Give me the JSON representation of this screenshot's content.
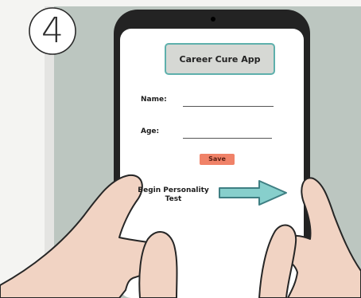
{
  "step": {
    "number": "4"
  },
  "app": {
    "title": "Career Cure App",
    "form": {
      "name_label": "Name:",
      "name_value": "",
      "age_label": "Age:",
      "age_value": "",
      "save_label": "Save"
    },
    "begin_test": {
      "line1": "Begin Personality",
      "line2": "Test"
    }
  },
  "colors": {
    "wall": "#bcc6c0",
    "phone": "#232323",
    "screen": "#ffffff",
    "title_box": "#d6d8d4",
    "title_border": "#5eb0ac",
    "save_button": "#f08268",
    "arrow_fill": "#87cfcc",
    "arrow_stroke": "#3f7f83",
    "skin": "#f1d3c3",
    "skin_outline": "#262626"
  },
  "icons": {
    "camera": "camera-dot-icon",
    "arrow": "right-arrow-icon"
  }
}
